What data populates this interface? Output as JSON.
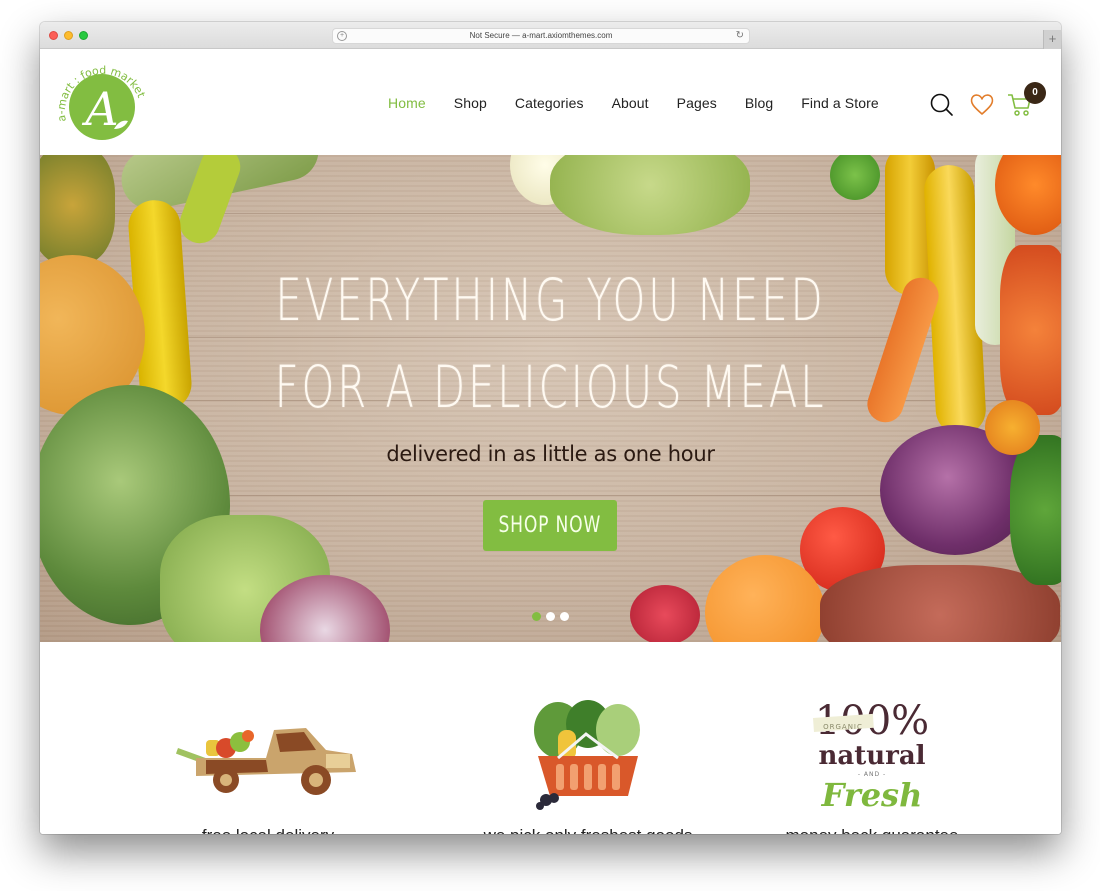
{
  "browser": {
    "url_text": "Not Secure — a-mart.axiomthemes.com",
    "new_tab_label": "+"
  },
  "brand": {
    "logo_letter": "A",
    "logo_ring_text": "a-mart : food market",
    "accent_color": "#82bd41",
    "heart_color": "#e27d2b",
    "dark_color": "#3a2716"
  },
  "nav": {
    "items": [
      {
        "label": "Home",
        "active": true
      },
      {
        "label": "Shop",
        "active": false
      },
      {
        "label": "Categories",
        "active": false
      },
      {
        "label": "About",
        "active": false
      },
      {
        "label": "Pages",
        "active": false
      },
      {
        "label": "Blog",
        "active": false
      },
      {
        "label": "Find a Store",
        "active": false
      }
    ],
    "icons": [
      "search-icon",
      "heart-icon",
      "cart-icon"
    ],
    "cart_count": "0"
  },
  "hero": {
    "title_line1": "EVERYTHING YOU NEED",
    "title_line2": "FOR A DELICIOUS MEAL",
    "subtitle": "delivered in as little as one hour",
    "cta_label": "SHOP NOW",
    "slides_total": 3,
    "active_slide": 1
  },
  "features": [
    {
      "icon": "delivery-truck-icon",
      "caption": "free local delivery"
    },
    {
      "icon": "vegetable-basket-icon",
      "caption": "we pick only freshest goods"
    },
    {
      "icon": "natural-fresh-badge-icon",
      "caption": "money back guarantee",
      "badge": {
        "top": "100%",
        "ribbon": "ORGANIC",
        "middle": "natural",
        "and": "- AND -",
        "bottom": "Fresh"
      }
    }
  ]
}
